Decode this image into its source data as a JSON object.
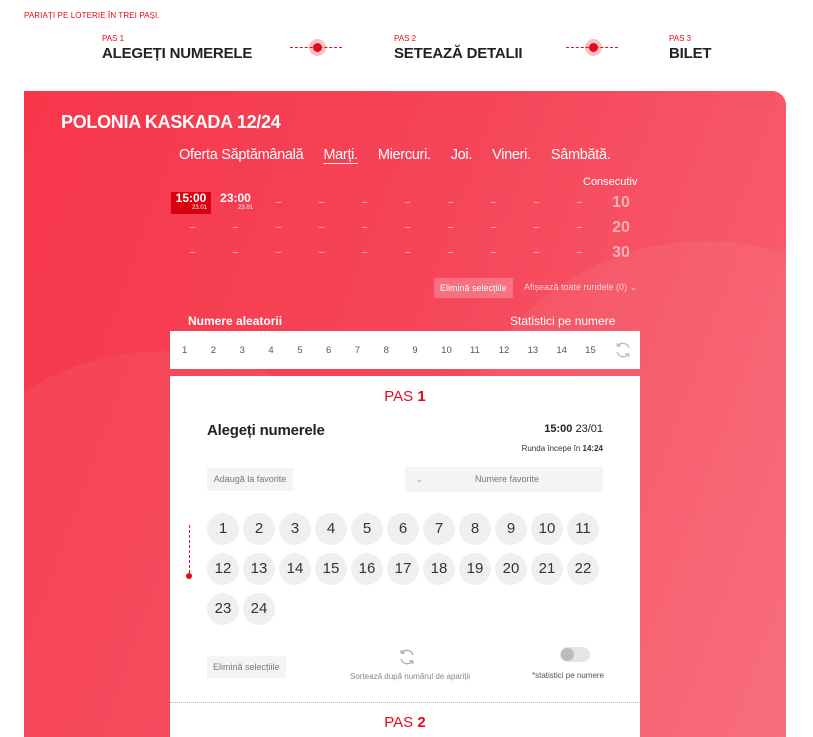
{
  "intro": "PARIAȚI PE LOTERIE ÎN TREI PAȘI.",
  "steps": [
    {
      "num": "PAS 1",
      "label": "ALEGEȚI NUMERELE"
    },
    {
      "num": "PAS 2",
      "label": "SETEAZĂ DETALII"
    },
    {
      "num": "PAS 3",
      "label": "BILET"
    }
  ],
  "game_title": "POLONIA KASKADA 12/24",
  "days": [
    "Oferta Săptămânală",
    "Marți.",
    "Miercuri.",
    "Joi.",
    "Vineri.",
    "Sâmbătă."
  ],
  "active_day": "Marți.",
  "consecutive_label": "Consecutiv",
  "draws": {
    "selected": {
      "time": "15:00",
      "date": "23.01"
    },
    "second": {
      "time": "23:00",
      "date": "23.01"
    },
    "dash": "–",
    "consecutive": [
      "10",
      "20",
      "30"
    ]
  },
  "clear_selection_top": "Elimină selecțiile",
  "show_all_rounds": "Afișează toate rundele (0)",
  "random_numbers_label": "Numere aleatorii",
  "stats_label": "Statistici pe numere",
  "random_numbers": [
    "1",
    "2",
    "3",
    "4",
    "5",
    "6",
    "7",
    "8",
    "9",
    "10",
    "11",
    "12",
    "13",
    "14",
    "15"
  ],
  "card": {
    "pas_top": {
      "word": "PAS",
      "num": "1"
    },
    "title": "Alegeți numerele",
    "time": "15:00",
    "date": "23/01",
    "round_prefix": "Runda începe în",
    "round_time": "14:24",
    "add_favorites": "Adaugă la favorite",
    "favorite_numbers": "Numere favorite",
    "numbers": [
      "1",
      "2",
      "3",
      "4",
      "5",
      "6",
      "7",
      "8",
      "9",
      "10",
      "11",
      "12",
      "13",
      "14",
      "15",
      "16",
      "17",
      "18",
      "19",
      "20",
      "21",
      "22",
      "23",
      "24"
    ],
    "clear_selection": "Elimină selecțiile",
    "sort_label": "Sortează după numărul de apariții",
    "stats_toggle_label": "*statistici pe numere",
    "pas_bottom": {
      "word": "PAS",
      "num": "2"
    }
  },
  "colors": {
    "accent": "#e30a1a",
    "panel": "#f5404f"
  }
}
